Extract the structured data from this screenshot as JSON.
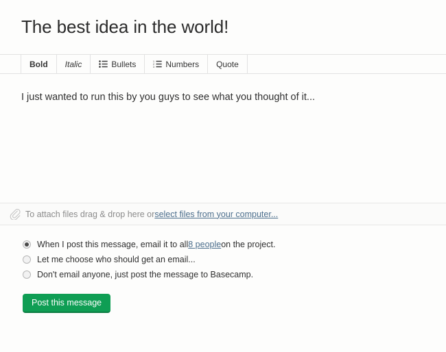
{
  "message_form": {
    "title": "The best idea in the world!",
    "body_text": "I just wanted to run this by you guys to see what you thought of it...",
    "toolbar": {
      "bold_label": "Bold",
      "italic_label": "Italic",
      "bullets_label": "Bullets",
      "numbers_label": "Numbers",
      "quote_label": "Quote",
      "bullets_icon": "bulleted-list-icon",
      "numbers_icon": "numbered-list-icon"
    },
    "attach": {
      "icon": "paperclip-icon",
      "prompt_text": "To attach files drag & drop here or ",
      "link_text": "select files from your computer..."
    },
    "notify_options": [
      {
        "selected": true,
        "text_before": "When I post this message, email it to all ",
        "link_text": "8 people",
        "text_after": " on the project."
      },
      {
        "selected": false,
        "text_before": "Let me choose who should get an email...",
        "link_text": "",
        "text_after": ""
      },
      {
        "selected": false,
        "text_before": "Don't email anyone, just post the message to Basecamp.",
        "link_text": "",
        "text_after": ""
      }
    ],
    "submit_label": "Post this message",
    "colors": {
      "accent_green": "#0f9e54",
      "link_blue": "#4d6f8d",
      "muted_text": "#8b8b8b",
      "border": "#e2e2e2"
    }
  }
}
